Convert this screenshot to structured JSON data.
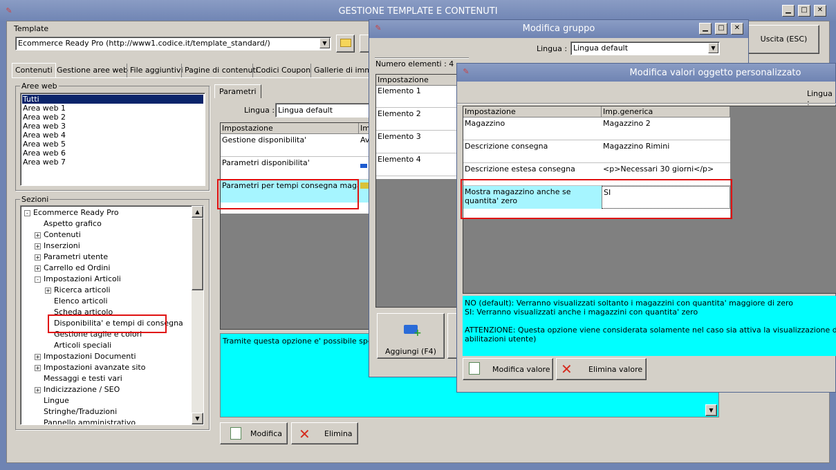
{
  "main": {
    "title": "GESTIONE TEMPLATE E CONTENUTI",
    "template_label": "Template",
    "template_value": "Ecommerce Ready Pro (http://www1.codice.it/template_standard/)",
    "exit_button": "Uscita (ESC)",
    "tabs": [
      "Contenuti",
      "Gestione aree web",
      "File aggiuntivi",
      "Pagine di contenuti",
      "Codici Coupon",
      "Gallerie di immag"
    ],
    "areas_label": "Aree web",
    "areas": [
      "Tutti",
      "Area web 1",
      "Area web 2",
      "Area web 3",
      "Area web 4",
      "Area web 5",
      "Area web 6",
      "Area web 7"
    ],
    "sections_label": "Sezioni",
    "tree": [
      {
        "label": "Ecommerce Ready Pro",
        "level": 0,
        "exp": "-"
      },
      {
        "label": "Aspetto grafico",
        "level": 1,
        "exp": ""
      },
      {
        "label": "Contenuti",
        "level": 1,
        "exp": "+"
      },
      {
        "label": "Inserzioni",
        "level": 1,
        "exp": "+"
      },
      {
        "label": "Parametri utente",
        "level": 1,
        "exp": "+"
      },
      {
        "label": "Carrello ed Ordini",
        "level": 1,
        "exp": "+"
      },
      {
        "label": "Impostazioni Articoli",
        "level": 1,
        "exp": "-"
      },
      {
        "label": "Ricerca articoli",
        "level": 2,
        "exp": "+"
      },
      {
        "label": "Elenco articoli",
        "level": 2,
        "exp": ""
      },
      {
        "label": "Scheda articolo",
        "level": 2,
        "exp": ""
      },
      {
        "label": "Disponibilita' e tempi di consegna",
        "level": 2,
        "exp": ""
      },
      {
        "label": "Gestione taglie e colori",
        "level": 2,
        "exp": ""
      },
      {
        "label": "Articoli speciali",
        "level": 2,
        "exp": ""
      },
      {
        "label": "Impostazioni Documenti",
        "level": 1,
        "exp": "+"
      },
      {
        "label": "Impostazioni avanzate sito",
        "level": 1,
        "exp": "+"
      },
      {
        "label": "Messaggi e testi vari",
        "level": 1,
        "exp": ""
      },
      {
        "label": "Indicizzazione / SEO",
        "level": 1,
        "exp": "+"
      },
      {
        "label": "Lingue",
        "level": 1,
        "exp": ""
      },
      {
        "label": "Stringhe/Traduzioni",
        "level": 1,
        "exp": ""
      },
      {
        "label": "Pannello amministrativo",
        "level": 1,
        "exp": ""
      }
    ],
    "params_tab": "Parametri",
    "lingua_label": "Lingua :",
    "lingua_value": "Lingua default",
    "grid_headers": [
      "Impostazione",
      "Im"
    ],
    "grid_rows": [
      {
        "name": "Gestione disponibilita'",
        "val": "Av"
      },
      {
        "name": "Parametri disponibilita'",
        "val": ""
      },
      {
        "name": "Parametri per tempi consegna magazzini",
        "val": ""
      }
    ],
    "description": "Tramite questa opzione e' possibile specificar",
    "modify_button": "Modifica",
    "delete_button": "Elimina"
  },
  "group_window": {
    "title": "Modifica gruppo",
    "lingua_label": "Lingua :",
    "lingua_value": "Lingua default",
    "count": "Numero elementi : 4",
    "header": "Impostazione",
    "elements": [
      "Elemento 1",
      "Elemento 2",
      "Elemento 3",
      "Elemento 4"
    ],
    "add_button": "Aggiungi (F4)"
  },
  "values_window": {
    "title": "Modifica valori oggetto personalizzato",
    "lingua_label": "Lingua :",
    "headers": [
      "Impostazione",
      "Imp.generica"
    ],
    "rows": [
      {
        "name": "Magazzino",
        "val": "Magazzino 2"
      },
      {
        "name": "Descrizione consegna",
        "val": "Magazzino Rimini"
      },
      {
        "name": "Descrizione estesa consegna",
        "val": "<p>Necessari 30 giorni</p>"
      },
      {
        "name": "Mostra magazzino anche se quantita' zero",
        "val": "SI"
      }
    ],
    "help_lines": [
      "NO (default): Verranno visualizzati soltanto i magazzini con quantita' maggiore di zero",
      "SI: Verranno visualizzati anche i magazzini con quantita' zero",
      "",
      "ATTENZIONE: Questa opzione viene considerata solamente nel caso sia attiva la visualizzazione delle giacenze (t",
      "abilitazioni utente)"
    ],
    "modify_value_button": "Modifica valore",
    "delete_value_button": "Elimina valore"
  },
  "colors": {
    "highlight": "#0a246a",
    "cyan": "#00ffff",
    "light_cyan": "#a6f5ff",
    "red": "#e01010"
  },
  "icons": [
    "app-icon",
    "folder-icon",
    "edit-icon",
    "delete-icon",
    "add-icon",
    "minimize-icon",
    "maximize-icon",
    "close-icon",
    "dropdown-icon"
  ]
}
